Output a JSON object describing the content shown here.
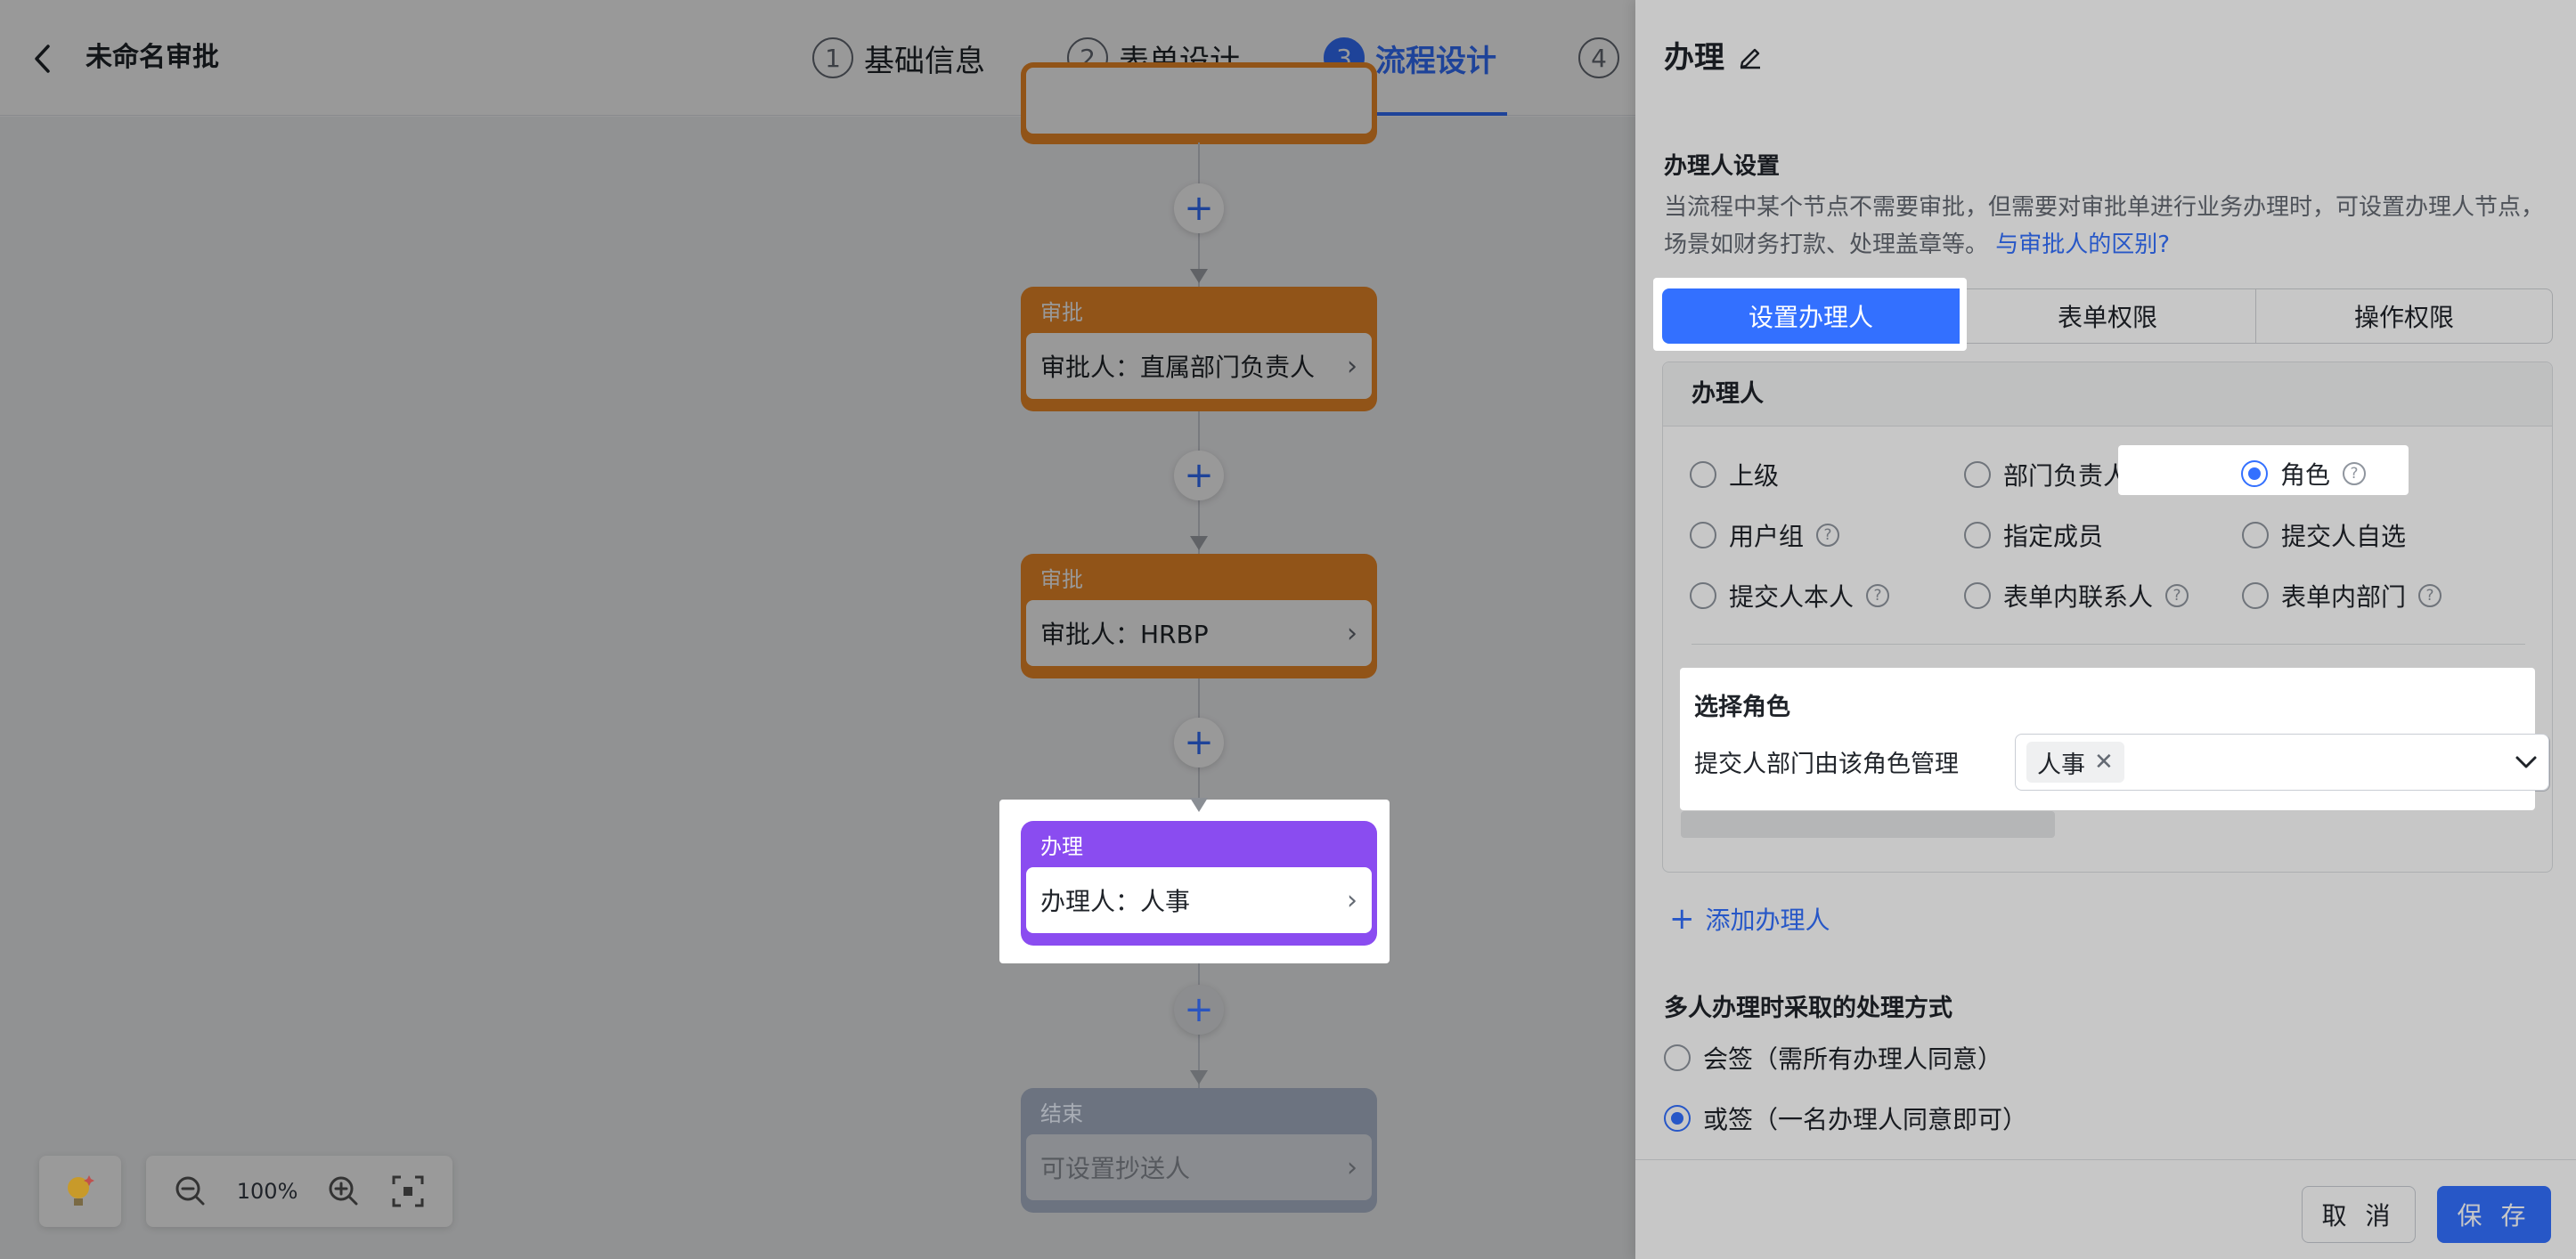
{
  "header": {
    "title": "未命名审批",
    "steps": [
      {
        "num": "1",
        "label": "基础信息"
      },
      {
        "num": "2",
        "label": "表单设计"
      },
      {
        "num": "3",
        "label": "流程设计"
      },
      {
        "num": "4",
        "label": ""
      }
    ],
    "active_step": 2
  },
  "canvas": {
    "nodes": [
      {
        "type": "审批",
        "text": "审批人：直属部门负责人"
      },
      {
        "type": "审批",
        "text": "审批人：HRBP"
      },
      {
        "type": "办理",
        "text": "办理人：人事"
      },
      {
        "type": "结束",
        "text": "可设置抄送人"
      }
    ],
    "zoom": "100%"
  },
  "panel": {
    "title": "办理",
    "section_title": "办理人设置",
    "section_desc": "当流程中某个节点不需要审批，但需要对审批单进行业务办理时，可设置办理人节点，场景如财务打款、处理盖章等。",
    "section_link": "与审批人的区别?",
    "tabs": [
      "设置办理人",
      "表单权限",
      "操作权限"
    ],
    "box_title": "办理人",
    "options": [
      {
        "label": "上级",
        "help": false,
        "checked": false
      },
      {
        "label": "部门负责人",
        "help": true,
        "checked": false
      },
      {
        "label": "角色",
        "help": true,
        "checked": true
      },
      {
        "label": "用户组",
        "help": true,
        "checked": false
      },
      {
        "label": "指定成员",
        "help": false,
        "checked": false
      },
      {
        "label": "提交人自选",
        "help": false,
        "checked": false
      },
      {
        "label": "提交人本人",
        "help": true,
        "checked": false
      },
      {
        "label": "表单内联系人",
        "help": true,
        "checked": false
      },
      {
        "label": "表单内部门",
        "help": true,
        "checked": false
      }
    ],
    "select_title": "选择角色",
    "select_label": "提交人部门由该角色管理",
    "selected_tag": "人事",
    "add_handler": "添加办理人",
    "multi_title": "多人办理时采取的处理方式",
    "multi_options": [
      {
        "label": "会签（需所有办理人同意）",
        "checked": false
      },
      {
        "label": "或签（一名办理人同意即可）",
        "checked": true
      }
    ],
    "cancel": "取 消",
    "save": "保 存"
  },
  "colors": {
    "accent": "#3370ff",
    "approve_node": "#f28c28",
    "handle_node": "#8a4cf0",
    "end_node": "#b4bcc9"
  }
}
